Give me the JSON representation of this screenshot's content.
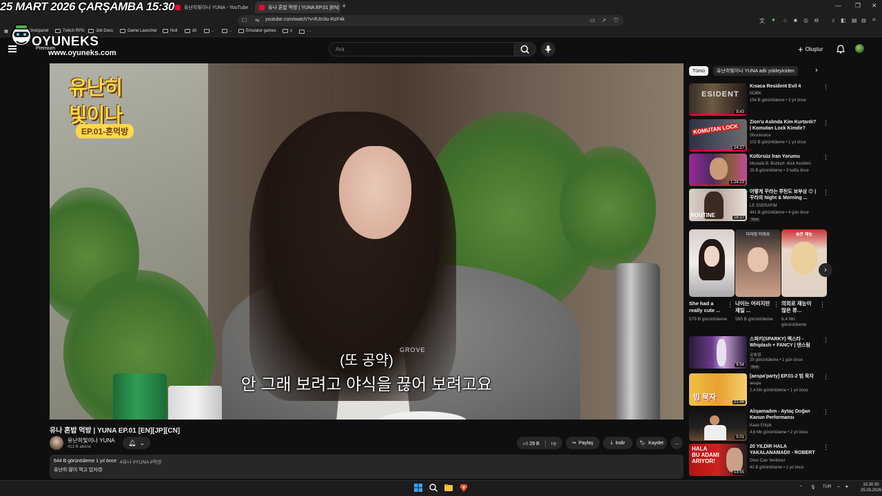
{
  "overlay": {
    "datestamp": "25 MART 2026 ÇARŞAMBA 15:30",
    "logo_text": "OYUNEKS",
    "logo_url": "www.oyuneks.com"
  },
  "browser": {
    "tabs": [
      {
        "title": "유난히빛이나 YUNA - YouTube",
        "active": false
      },
      {
        "title": "유나 혼밥 먹방 | YUNA EP.01 [EN]",
        "active": true
      }
    ],
    "url": "youtube.com/watch?v=fUIn3u-RzF4k",
    "bookmarks": [
      "Yönetpanel",
      "Twitch RPG",
      "Job Docs",
      "Game Launcher",
      "Null",
      "dil",
      "..",
      "..",
      "Emulator games",
      "x"
    ]
  },
  "youtube_header": {
    "premium_label": "Premium",
    "search_placeholder": "Ara",
    "create_label": "Oluştur"
  },
  "player": {
    "show_logo_line1": "유난히",
    "show_logo_line2": "빛이나",
    "show_episode": "EP.01-혼먹방",
    "subtitle_line1": "(또 공약)",
    "subtitle_line2": "안 그래 보려고 야식을 끊어 보려고요",
    "apron_text": "GROVE"
  },
  "video": {
    "title": "유나 혼밥 먹방 | YUNA EP.01 [EN][JP][CN]",
    "channel_name": "유난히빛이나 YUNA",
    "subscribers": "413 B abone",
    "likes": "29 B",
    "share_label": "Paylaş",
    "download_label": "İndir",
    "save_label": "Kaydet",
    "more_label": "...",
    "description": {
      "views_time": "644 B görüntüleme  1 yıl önce",
      "tags": "#유나 #YUNA #먹방",
      "text": "유난히 많이 먹고 있지😊"
    }
  },
  "sidebar": {
    "chips": [
      "Tümü",
      "유난히빛이나 YUNA adlı yükleyiciden"
    ],
    "recommendations": [
      {
        "title": "Kısaca Resident Evil 4",
        "channel": "NOBK",
        "meta": "154 B görüntüleme • 3 yıl önce",
        "duration": "8:43",
        "badge": ""
      },
      {
        "title": "Zion'u Aslında Kim Kurtardı? | Komutan Lock Kimdir?",
        "channel": "Shockvoice",
        "meta": "102 B görüntüleme • 1 yıl önce",
        "duration": "24:17",
        "badge": ""
      },
      {
        "title": "Küfürsüz İran Yorumu",
        "channel": "Mustafa B. Bozkurt -Kick Kesitleri",
        "meta": "25 B görüntüleme • 3 hafta önce",
        "duration": "1:24:23",
        "badge": ""
      },
      {
        "title": "어떻게 꾸라는 루틴도 보부상 😊 | 꾸라의 Night & Morning ...",
        "channel": "LE SSERAFIM",
        "meta": "441 B görüntüleme • 4 gün önce",
        "duration": "18:17",
        "badge": "Yeni"
      }
    ],
    "shorts": [
      {
        "title": "She had a really cute ...",
        "views": "579 B görüntüleme"
      },
      {
        "title": "나이는 어리지만 제일 ...",
        "views": "593 B görüntüleme"
      },
      {
        "title": "의외로 재능이 많은 류...",
        "views": "6,4 Mn görüntüleme"
      }
    ],
    "recommendations2": [
      {
        "title": "스파키(SPARKY) 엑스타 - Whiplash + FANCY | 댄스팀 스...",
        "channel": "유튜영",
        "meta": "25 görüntüleme • 1 gün önce",
        "duration": "6:54",
        "badge": "Yeni"
      },
      {
        "title": "[aespa'party] EP.01-2 빔 묵자",
        "channel": "aespa",
        "meta": "2,4 Mn görüntüleme • 1 yıl önce",
        "duration": "21:46",
        "badge": ""
      },
      {
        "title": "Alışamadım - Aytaç Doğan Kanun Performansı",
        "channel": "Kaan Erlişik",
        "meta": "4,6 Mn görüntüleme • 2 yıl önce",
        "duration": "5:01",
        "badge": ""
      },
      {
        "title": "20 YILDIR HALA YAKALANAMADI! - ROBERT ...",
        "channel": "Onur Can Yeniimez",
        "meta": "42 B görüntüleme • 1 yıl önce",
        "duration": "13:55",
        "badge": ""
      }
    ]
  },
  "taskbar": {
    "lang": "TUR",
    "time": "15:30:30",
    "date": "25.03.2026"
  }
}
